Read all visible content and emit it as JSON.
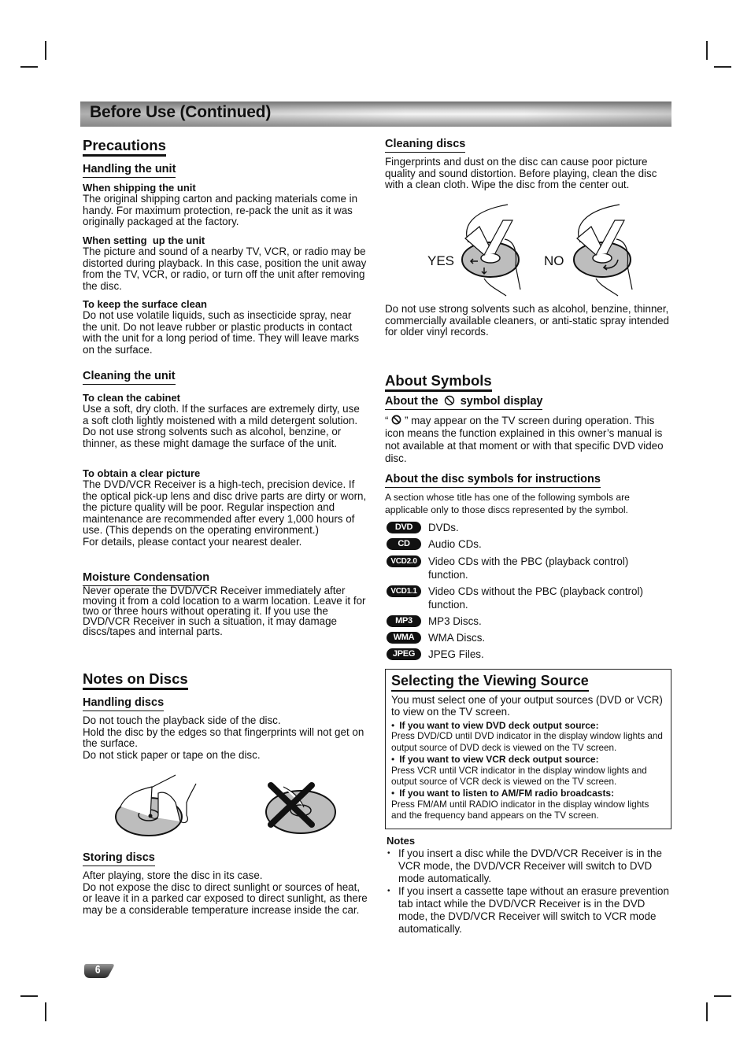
{
  "page": {
    "banner_title": "Before Use (Continued)",
    "page_number": "6"
  },
  "left": {
    "precautions": {
      "title": "Precautions",
      "handling_unit": {
        "title": "Handling the unit",
        "items": [
          {
            "heading": "When shipping the unit",
            "body": "The original shipping carton and packing materials come in handy. For maximum protection, re-pack the unit as it was originally packaged at the factory."
          },
          {
            "heading": "When setting  up the unit",
            "body": "The picture and sound of a nearby TV, VCR, or radio may be distorted during playback. In this case, position the unit away from the TV, VCR, or radio, or turn off the unit after removing the disc."
          },
          {
            "heading": "To keep the surface clean",
            "body": "Do not use volatile liquids, such as insecticide spray, near the unit. Do not leave rubber or plastic products in contact with the unit for a long period of time. They will leave marks on the surface."
          }
        ]
      },
      "cleaning_unit": {
        "title": "Cleaning the unit",
        "items": [
          {
            "heading": "To clean the cabinet",
            "body": "Use a soft, dry cloth. If the surfaces are extremely dirty, use a soft cloth lightly moistened with a mild detergent solution. Do not use strong solvents such as alcohol, benzine, or thinner, as these might damage the surface of the unit."
          },
          {
            "heading": "To obtain a clear picture",
            "body": "The DVD/VCR Receiver is a high-tech, precision device. If the optical pick-up lens and disc drive parts are dirty or worn, the picture quality will be poor. Regular inspection and maintenance are recommended after every 1,000 hours of use. (This depends on the operating environment.)",
            "body2": "For details, please contact your nearest dealer."
          }
        ]
      },
      "moisture": {
        "title": "Moisture Condensation",
        "body": "Never operate the DVD/VCR Receiver immediately after moving it from a cold location to a warm location. Leave it for two or three hours without operating it. If you use the DVD/VCR Receiver in such a situation, it may damage discs/tapes and internal parts."
      }
    },
    "notes_on_discs": {
      "title": "Notes on Discs",
      "handling": {
        "title": "Handling discs",
        "lines": [
          "Do not touch the playback side of the disc.",
          "Hold the disc by the edges so that fingerprints will not get on the surface.",
          "Do not stick paper or tape on the disc."
        ]
      },
      "storing": {
        "title": "Storing discs",
        "lines": [
          "After playing, store the disc in its case.",
          "Do not expose the disc to direct sunlight or sources of heat, or leave it in a parked car exposed to direct sunlight, as there may be a considerable temperature increase inside the car."
        ]
      }
    }
  },
  "right": {
    "cleaning_discs": {
      "title": "Cleaning discs",
      "body": "Fingerprints and dust on the disc can cause poor picture quality and sound distortion. Before playing, clean the disc with a clean cloth. Wipe the disc from the center out.",
      "yes_label": "YES",
      "no_label": "NO",
      "body2": "Do not use strong solvents such as alcohol, benzine, thinner, commercially available cleaners, or anti-static spray intended for older vinyl records."
    },
    "about_symbols": {
      "title": "About Symbols",
      "symbol_display_title_pre": "About the",
      "symbol_display_title_post": "symbol display",
      "symbol_display_quote_open": "“",
      "symbol_display_body": "” may appear on the TV screen during operation. This icon means the function explained in this owner’s manual is not available at that moment or with that specific DVD video disc.",
      "disc_symbols_title": "About the disc symbols for instructions",
      "disc_symbols_intro": "A section whose title has one of the following symbols are applicable only to those discs represented by the symbol.",
      "symbols": [
        {
          "badge": "DVD",
          "desc": "DVDs."
        },
        {
          "badge": "CD",
          "desc": "Audio CDs."
        },
        {
          "badge": "VCD2.0",
          "desc": "Video CDs with the PBC (playback control) function."
        },
        {
          "badge": "VCD1.1",
          "desc": "Video CDs without the PBC (playback control) function."
        },
        {
          "badge": "MP3",
          "desc": "MP3 Discs."
        },
        {
          "badge": "WMA",
          "desc": "WMA Discs."
        },
        {
          "badge": "JPEG",
          "desc": "JPEG Files."
        }
      ]
    },
    "viewing_source": {
      "title": "Selecting the Viewing Source",
      "intro": "You must select one of your output sources (DVD or VCR) to view on the TV screen.",
      "items": [
        {
          "heading": "If you want to view DVD deck output source:",
          "body": "Press DVD/CD until DVD indicator in the display window lights and output source of DVD deck is viewed on the TV screen."
        },
        {
          "heading": "If you want to view VCR deck output source:",
          "body": "Press VCR until VCR indicator in the display window lights and output source of VCR deck is viewed on the TV screen."
        },
        {
          "heading": "If you want to listen to AM/FM radio broadcasts:",
          "body": "Press FM/AM until RADIO indicator in the display window lights and the frequency band appears on the TV screen."
        }
      ]
    },
    "notes": {
      "title": "Notes",
      "items": [
        "If you insert a disc while the DVD/VCR Receiver is in the VCR mode, the DVD/VCR Receiver will switch to DVD mode automatically.",
        "If you insert a cassette tape without an erasure prevention tab intact while the DVD/VCR Receiver is in the DVD mode, the DVD/VCR Receiver will switch to VCR mode automatically."
      ]
    }
  }
}
